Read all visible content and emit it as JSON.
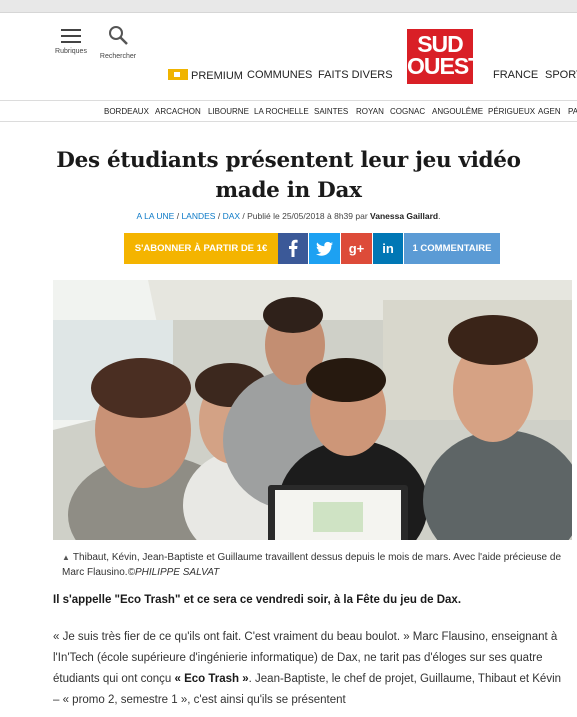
{
  "header": {
    "rubriques_label": "Rubriques",
    "rechercher_label": "Rechercher",
    "logo_line1": "SUD",
    "logo_line2": "OUEST",
    "nav": [
      "PREMIUM",
      "COMMUNES",
      "FAITS DIVERS",
      "FRANCE",
      "SPORT"
    ],
    "brand_color": "#d91f26",
    "premium_color": "#f0b400"
  },
  "cities": [
    "BORDEAUX",
    "ARCACHON",
    "LIBOURNE",
    "LA ROCHELLE",
    "SAINTES",
    "ROYAN",
    "COGNAC",
    "ANGOULÊME",
    "PÉRIGUEUX",
    "AGEN",
    "PA"
  ],
  "article": {
    "title": "Des étudiants présentent leur jeu vidéo made in Dax",
    "breadcrumb": [
      "A LA UNE",
      "LANDES",
      "DAX"
    ],
    "published": "Publié le 25/05/2018 à 8h39 par",
    "author": "Vanessa Gaillard",
    "subscribe_label": "S'ABONNER À PARTIR DE 1€",
    "facebook_icon": "facebook-icon",
    "twitter_icon": "twitter-icon",
    "googleplus_label": "g+",
    "linkedin_label": "in",
    "comments_label": "1 COMMENTAIRE",
    "caption": "Thibaut, Kévin, Jean-Baptiste et Guillaume travaillent dessus depuis le mois de mars. Avec l'aide précieuse de Marc Flausino.",
    "caption_credit": "©PHILIPPE SALVAT",
    "lead": "Il s'appelle \"Eco Trash\" et ce sera ce vendredi soir, à la Fête du jeu de Dax.",
    "body_1": "« Je suis très fier de ce qu'ils ont fait. C'est vraiment du beau boulot. » Marc Flausino, enseignant à l'In'Tech (école supérieure d'ingénierie informatique) de Dax, ne tarit pas d'éloges sur ses quatre étudiants qui ont conçu",
    "body_bold": "« Eco Trash »",
    "body_2": ". Jean-Baptiste, le chef de projet, Guillaume, Thibaut et Kévin – « promo 2, semestre 1 », c'est ainsi qu'ils se présentent"
  }
}
